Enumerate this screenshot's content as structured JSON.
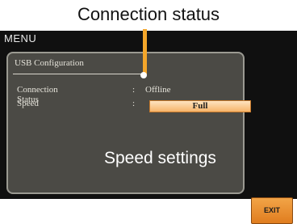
{
  "callouts": {
    "connection_status": "Connection status",
    "speed_settings": "Speed settings"
  },
  "menu": {
    "title": "MENU"
  },
  "usb_config": {
    "title": "USB Configuration",
    "connection_status_label": "Connection Status",
    "connection_status_colon": ":",
    "connection_status_value": "Offline",
    "speed_label": "Speed",
    "speed_colon": ":",
    "speed_value": "Full"
  },
  "buttons": {
    "exit_label": "EXIT"
  },
  "colors": {
    "accent": "#f4a62a",
    "screen_bg": "#101010",
    "panel_bg": "#4b4a45"
  }
}
